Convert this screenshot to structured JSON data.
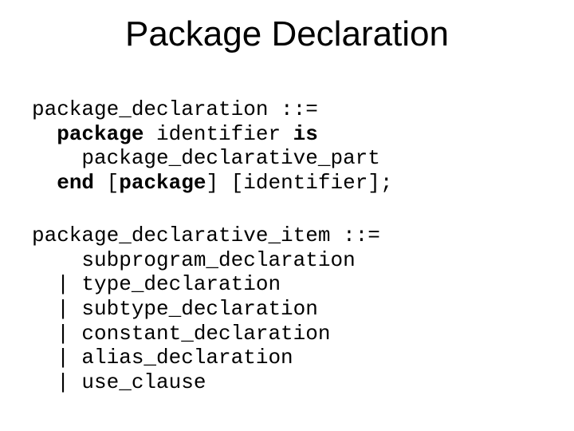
{
  "title": "Package Declaration",
  "grammar1": {
    "l1_a": "package_declaration ::=",
    "l2_a": "  ",
    "l2_b": "package",
    "l2_c": " identifier ",
    "l2_d": "is",
    "l3_a": "    package_declarative_part",
    "l4_a": "  ",
    "l4_b": "end",
    "l4_c": " [",
    "l4_d": "package",
    "l4_e": "] [identifier];"
  },
  "grammar2": {
    "l1": "package_declarative_item ::=",
    "l2": "    subprogram_declaration",
    "l3": "  | type_declaration",
    "l4": "  | subtype_declaration",
    "l5": "  | constant_declaration",
    "l6": "  | alias_declaration",
    "l7": "  | use_clause"
  }
}
